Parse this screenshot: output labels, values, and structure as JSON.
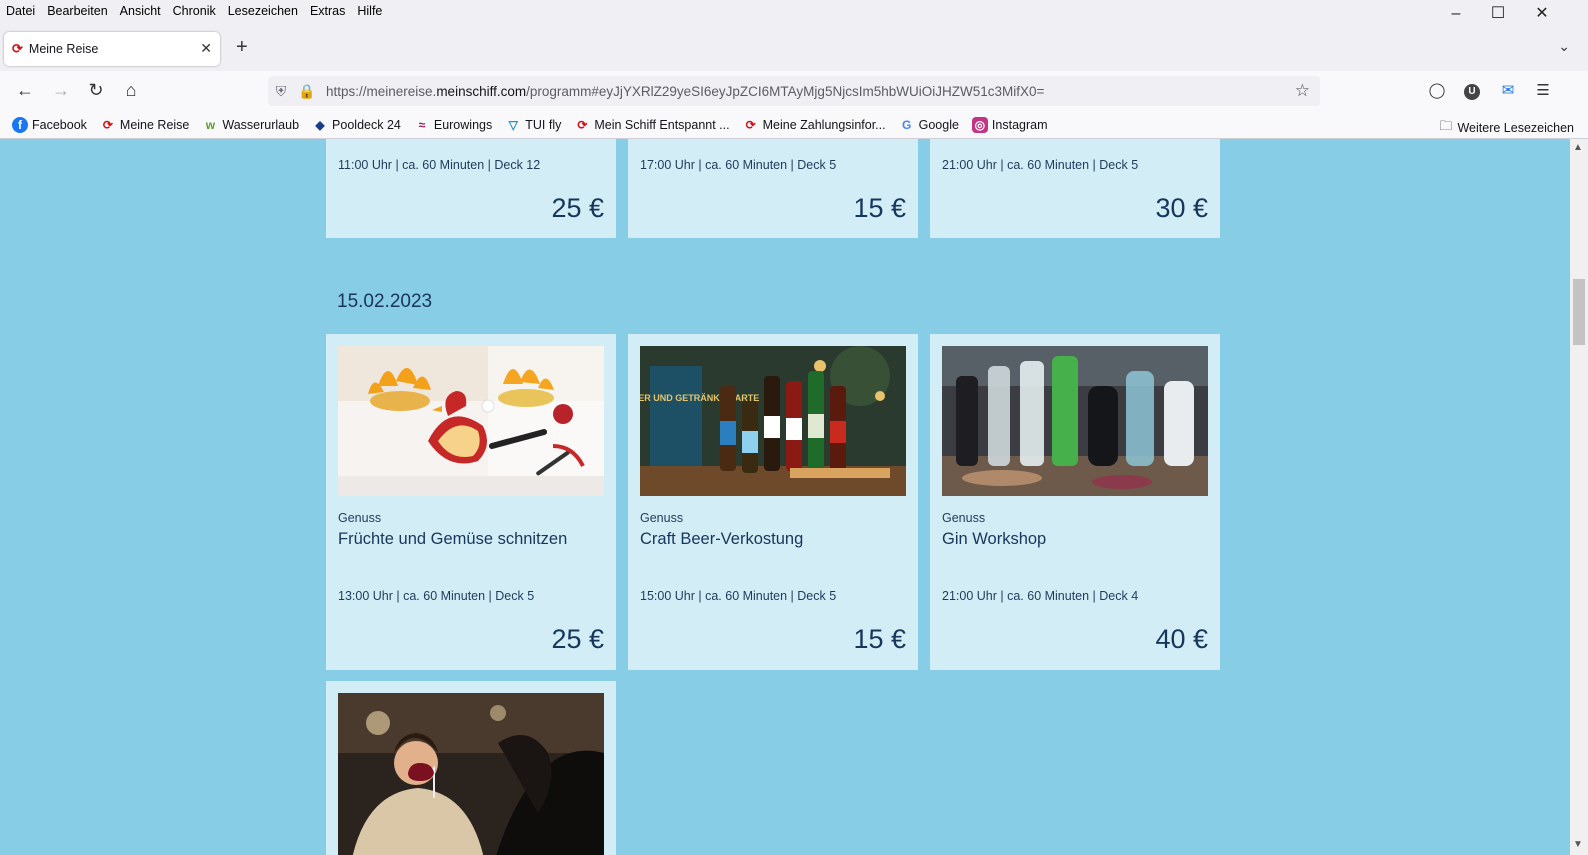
{
  "menu": [
    "Datei",
    "Bearbeiten",
    "Ansicht",
    "Chronik",
    "Lesezeichen",
    "Extras",
    "Hilfe"
  ],
  "tab": {
    "title": "Meine Reise"
  },
  "url": {
    "prefix": "https://meinereise.",
    "host": "meinschiff.com",
    "path": "/programm#eyJjYXRlZ29yeSI6eyJpZCI6MTAyMjg5NjcsIm5hbWUiOiJHZW51c3MifX0="
  },
  "bookmarks": [
    {
      "label": "Facebook",
      "icon": "facebook-icon",
      "color": "#1877f2"
    },
    {
      "label": "Meine Reise",
      "icon": "tui-icon",
      "color": "#d40e14"
    },
    {
      "label": "Wasserurlaub",
      "icon": "wasserurlaub-icon",
      "color": "#5aa02c"
    },
    {
      "label": "Pooldeck 24",
      "icon": "pooldeck-icon",
      "color": "#1a3c8a"
    },
    {
      "label": "Eurowings",
      "icon": "eurowings-icon",
      "color": "#a0195b"
    },
    {
      "label": "TUI fly",
      "icon": "tuifly-icon",
      "color": "#2d8fd5"
    },
    {
      "label": "Mein Schiff Entspannt ...",
      "icon": "tui-icon",
      "color": "#d40e14"
    },
    {
      "label": "Meine Zahlungsinfor...",
      "icon": "tui-icon",
      "color": "#d40e14"
    },
    {
      "label": "Google",
      "icon": "google-icon",
      "color": "#4285f4"
    },
    {
      "label": "Instagram",
      "icon": "instagram-icon",
      "color": "#c13584"
    }
  ],
  "bookmarks_more": "Weitere Lesezeichen",
  "top_cards": [
    {
      "meta": "11:00 Uhr | ca. 60 Minuten | Deck 12",
      "price": "25 €"
    },
    {
      "meta": "17:00 Uhr | ca. 60 Minuten | Deck 5",
      "price": "15 €"
    },
    {
      "meta": "21:00 Uhr | ca. 60 Minuten | Deck 5",
      "price": "30 €"
    }
  ],
  "date_heading": "15.02.2023",
  "cards": [
    {
      "category": "Genuss",
      "title": "Früchte und Gemüse schnitzen",
      "meta": "13:00 Uhr | ca. 60 Minuten | Deck 5",
      "price": "25 €"
    },
    {
      "category": "Genuss",
      "title": "Craft Beer-Verkostung",
      "meta": "15:00 Uhr | ca. 60 Minuten | Deck 5",
      "price": "15 €",
      "sign_text": "CRAFT BEER UND GETRÄNKE KARTE"
    },
    {
      "category": "Genuss",
      "title": "Gin Workshop",
      "meta": "21:00 Uhr | ca. 60 Minuten | Deck 4",
      "price": "40 €"
    }
  ],
  "colors": {
    "page_bg": "#87cde6",
    "card_bg": "#d3edf6",
    "text_dark": "#16365c",
    "brand_red": "#d40e14"
  }
}
